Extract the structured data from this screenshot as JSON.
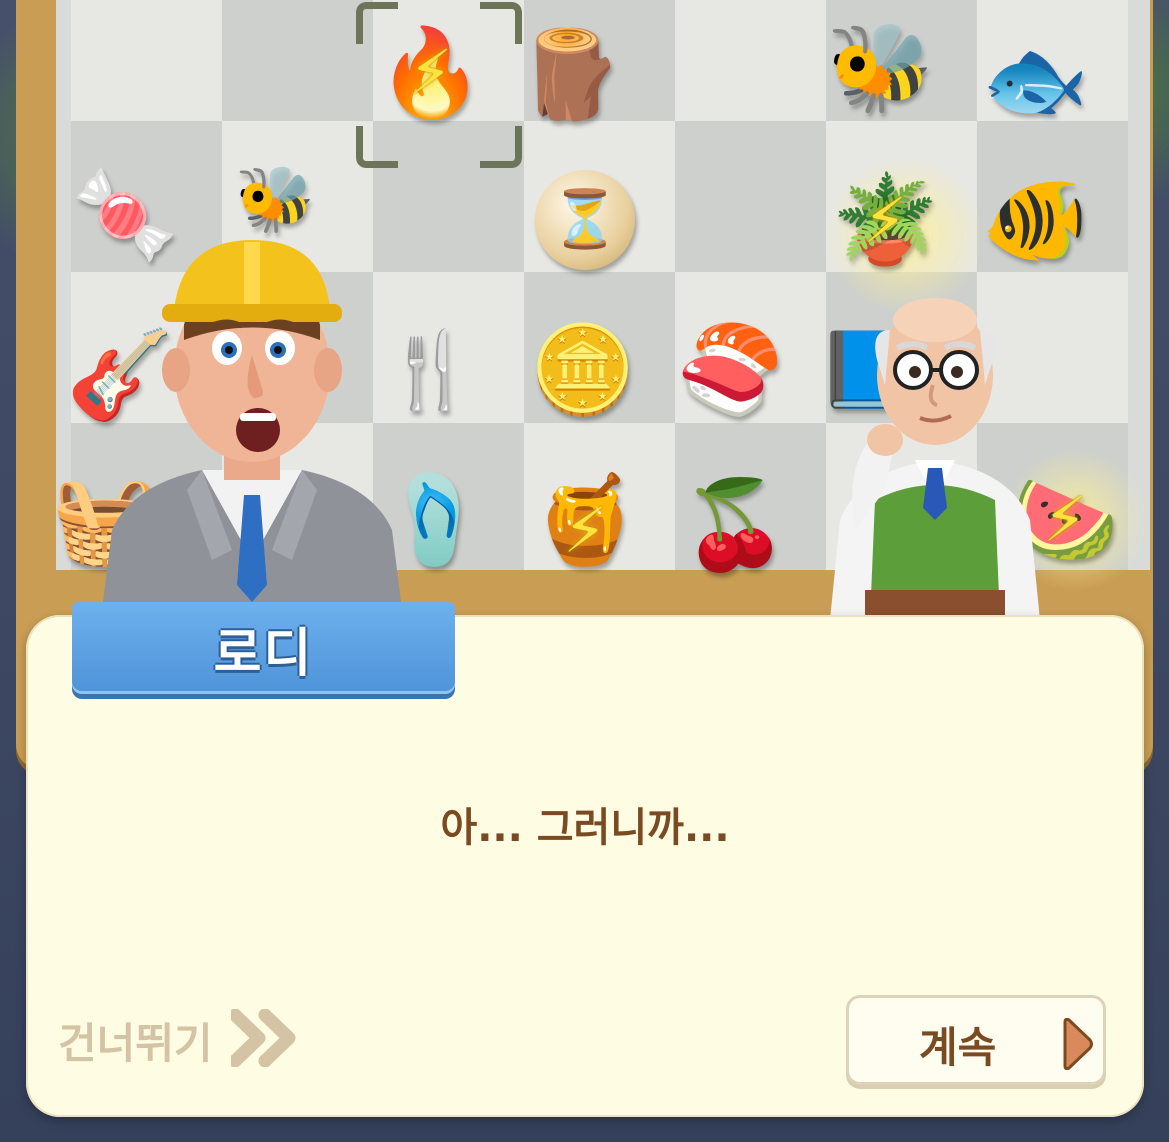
{
  "speaker": {
    "name": "로디"
  },
  "dialog": {
    "line": "아... 그러니까..."
  },
  "controls": {
    "skip_label": "건너뛰기",
    "skip_icon": "double-chevron-right-icon",
    "continue_label": "계속",
    "continue_icon": "play-triangle-icon"
  },
  "board_items": [
    {
      "name": "campfire-energy-item",
      "icon": "🔥"
    },
    {
      "name": "wood-log-item",
      "icon": "🪵"
    },
    {
      "name": "bee-item",
      "icon": "🐝"
    },
    {
      "name": "goldfish-item",
      "icon": "🐟"
    },
    {
      "name": "gummy-bears-item",
      "icon": "🍬"
    },
    {
      "name": "bees-item",
      "icon": "🐝"
    },
    {
      "name": "hourglass-bubble-item",
      "icon": "⏳"
    },
    {
      "name": "potted-plant-energy-item",
      "icon": "🪴"
    },
    {
      "name": "goldfish-item-2",
      "icon": "🐠"
    },
    {
      "name": "ukulele-item",
      "icon": "🎸"
    },
    {
      "name": "cutlery-cup-item",
      "icon": "🍴"
    },
    {
      "name": "coins-item",
      "icon": "🪙"
    },
    {
      "name": "sushi-rolls-item",
      "icon": "🍣"
    },
    {
      "name": "book-item",
      "icon": "📘"
    },
    {
      "name": "picnic-table-item",
      "icon": "🧺"
    },
    {
      "name": "flip-flops-item",
      "icon": "🩴"
    },
    {
      "name": "honey-jar-energy-item",
      "icon": "🍯"
    },
    {
      "name": "cherries-item",
      "icon": "🍒"
    },
    {
      "name": "watermelon-energy-item",
      "icon": "🍉"
    }
  ],
  "colors": {
    "name_tag": "#5aa0e4",
    "dialog_bg": "#fefce2",
    "text_brown": "#7a4b22",
    "skip_text": "#d4c3a4",
    "continue_arrow": "#d9895a"
  }
}
